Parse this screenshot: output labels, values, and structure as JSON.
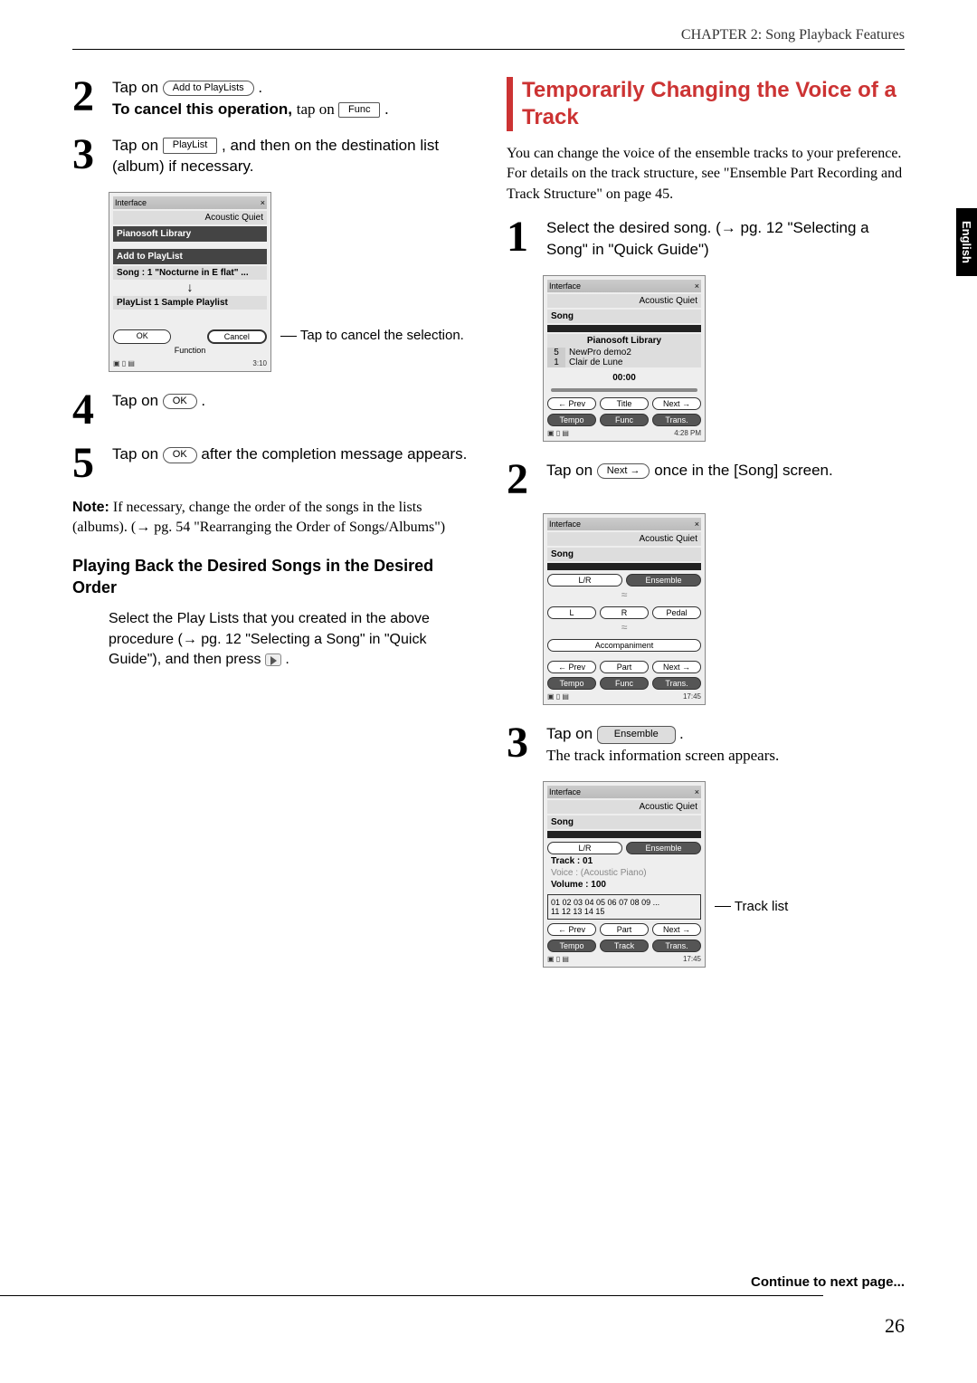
{
  "header": {
    "chapter": "CHAPTER 2: Song Playback Features"
  },
  "sidetab": "English",
  "left": {
    "step2": {
      "line1_a": "Tap on ",
      "btn1": "Add to PlayLists",
      "line1_b": ".",
      "line2_a": "To cancel this operation, ",
      "line2_b": "tap on ",
      "btn2": "Func",
      "line2_c": "."
    },
    "step3": {
      "line1_a": "Tap on ",
      "btn1": "PlayList",
      "line1_b": ", and then on the destination list (album) if necessary."
    },
    "fig3": {
      "title": "Interface",
      "quiet": "Acoustic  Quiet",
      "lib": "Pianosoft Library",
      "add": "Add to PlayList",
      "song": "Song :   1 \"Nocturne in E flat\"  ...",
      "playlist": "PlayList  1 Sample Playlist",
      "ok": "OK",
      "cancel": "Cancel",
      "func": "Function",
      "status": "3:10",
      "annot": "Tap to cancel the selection."
    },
    "step4": {
      "line_a": "Tap on ",
      "btn": "OK",
      "line_b": "."
    },
    "step5": {
      "line_a": "Tap on ",
      "btn": "OK",
      "line_b": " after the completion message appears."
    },
    "note": {
      "label": "Note:",
      "body": " If necessary, change the order of the songs in the lists (albums). (→ pg. 54 \"Rearranging the Order of Songs/Albums\")"
    },
    "sub": "Playing Back the Desired Songs in the Desired Order",
    "subbody_a": "Select the Play Lists that you created in the above procedure (→ pg. 12 \"Selecting a Song\" in \"Quick Guide\"), and then press ",
    "subbody_b": " ."
  },
  "right": {
    "section_title": "Temporarily Changing the Voice of a Track",
    "intro": "You can change the voice of the ensemble tracks to your preference. For details on the track structure, see \"Ensemble Part Recording and Track Structure\" on page 45.",
    "step1": "Select the desired song. (→ pg. 12 \"Selecting a Song\" in \"Quick Guide\")",
    "fig1": {
      "title": "Interface",
      "quiet": "Acoustic  Quiet",
      "song": "Song",
      "lib": "Pianosoft Library",
      "row1n": "5",
      "row1": "NewPro demo2",
      "row2n": "1",
      "row2": "Clair de Lune",
      "time": "00:00",
      "prev": "← Prev",
      "titleb": "Title",
      "next": "Next →",
      "tempo": "Tempo",
      "func": "Func",
      "trans": "Trans.",
      "status": "4:28 PM"
    },
    "step2": {
      "line_a": "Tap on ",
      "btn": "Next →",
      "line_b": " once in the [Song] screen."
    },
    "fig2": {
      "title": "Interface",
      "quiet": "Acoustic  Quiet",
      "song": "Song",
      "lr": "L/R",
      "ens": "Ensemble",
      "L": "L",
      "R": "R",
      "pedal": "Pedal",
      "accomp": "Accompaniment",
      "prev": "← Prev",
      "part": "Part",
      "next": "Next →",
      "tempo": "Tempo",
      "func": "Func",
      "trans": "Trans.",
      "status": "17:45"
    },
    "step3": {
      "line_a": "Tap on ",
      "btn": "Ensemble",
      "line_b": ".",
      "after": "The track information screen appears."
    },
    "fig3": {
      "title": "Interface",
      "quiet": "Acoustic  Quiet",
      "song": "Song",
      "lr": "L/R",
      "ens": "Ensemble",
      "track": "Track   : 01",
      "voice": "Voice    : (Acoustic Piano)",
      "volume": "Volume : 100",
      "nums": "01 02 03 04 05 06 07 08 09 ...\n11 12 13 14 15",
      "prev": "← Prev",
      "part": "Part",
      "next": "Next →",
      "tempo": "Tempo",
      "trackb": "Track",
      "trans": "Trans.",
      "status": "17:45",
      "annot": "Track list"
    }
  },
  "footer": {
    "continue": "Continue to next page...",
    "page": "26"
  }
}
